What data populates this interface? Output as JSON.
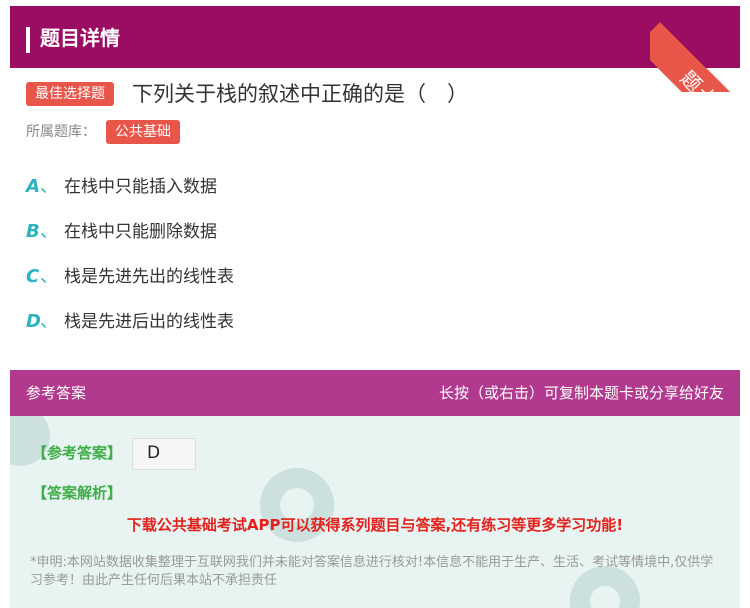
{
  "header": {
    "title": "题目详情",
    "ribbon_text": "题卡"
  },
  "question": {
    "type_tag": "最佳选择题",
    "text": "下列关于栈的叙述中正确的是（　）",
    "bank_label": "所属题库：",
    "bank_name": "公共基础"
  },
  "options": [
    {
      "letter": "A",
      "sep": "、",
      "text": "在栈中只能插入数据"
    },
    {
      "letter": "B",
      "sep": "、",
      "text": "在栈中只能删除数据"
    },
    {
      "letter": "C",
      "sep": "、",
      "text": "栈是先进先出的线性表"
    },
    {
      "letter": "D",
      "sep": "、",
      "text": "栈是先进后出的线性表"
    }
  ],
  "answer": {
    "section_title": "参考答案",
    "hint": "长按（或右击）可复制本题卡或分享给好友",
    "ref_label": "【参考答案】",
    "ref_value": "D",
    "analysis_label": "【答案解析】",
    "promo": "下载公共基础考试APP可以获得系列题目与答案,还有练习等更多学习功能!",
    "disclaimer": "*申明:本网站数据收集整理于互联网我们并未能对答案信息进行核对!本信息不能用于生产、生活、考试等情境中,仅供学习参考！由此产生任何后果本站不承担责任"
  },
  "colors": {
    "header_bg": "#9b0d63",
    "answer_head_bg": "#b13a8f",
    "tag_bg": "#e8564a",
    "option_letter": "#2bb3c0",
    "answer_label": "#3fae49",
    "promo_text": "#e4201c"
  }
}
